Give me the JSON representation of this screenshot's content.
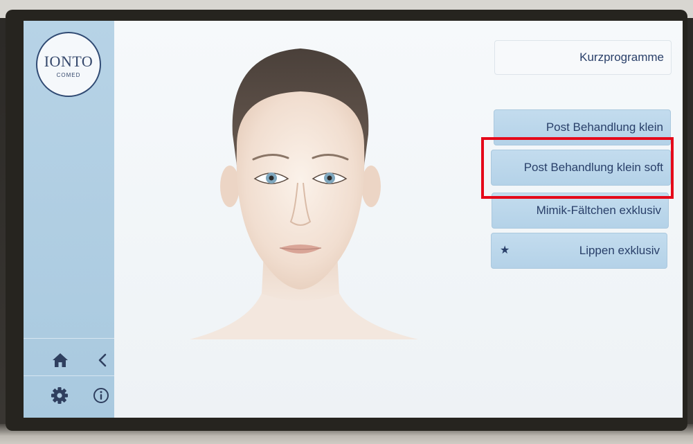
{
  "logo": {
    "main": "IONTO",
    "sub": "COMED"
  },
  "header_button": {
    "label": "Kurzprogramme"
  },
  "programs": [
    {
      "label": "Post Behandlung klein",
      "starred": false
    },
    {
      "label": "Post Behandlung klein soft",
      "starred": false
    },
    {
      "label": "Mimik-Fältchen exklusiv",
      "starred": false
    },
    {
      "label": "Lippen exklusiv",
      "starred": true
    }
  ],
  "star_glyph": "★",
  "sidebar": {
    "icons": [
      "home-icon",
      "back-chevron-icon",
      "gear-icon",
      "info-icon"
    ]
  },
  "colors": {
    "accent_text": "#293f69",
    "button_blue": "#b4d2e8",
    "sidebar_blue": "#a9c9df",
    "highlight_red": "#e5091a"
  }
}
